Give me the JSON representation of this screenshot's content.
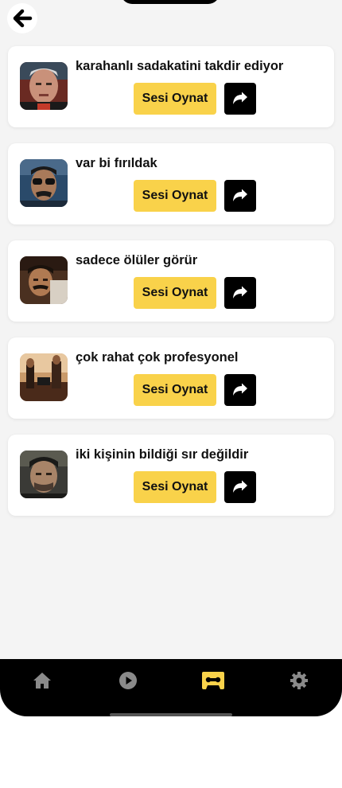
{
  "header": {
    "back_icon": "arrow-left-icon"
  },
  "sounds": [
    {
      "title": "karahanlı sadakatini takdir ediyor",
      "play_label": "Sesi Oynat",
      "share_icon": "share-arrow-icon"
    },
    {
      "title": "var bi fırıldak",
      "play_label": "Sesi Oynat",
      "share_icon": "share-arrow-icon"
    },
    {
      "title": "sadece ölüler görür",
      "play_label": "Sesi Oynat",
      "share_icon": "share-arrow-icon"
    },
    {
      "title": "çok rahat çok profesyonel",
      "play_label": "Sesi Oynat",
      "share_icon": "share-arrow-icon"
    },
    {
      "title": "iki kişinin bildiği sır değildir",
      "play_label": "Sesi Oynat",
      "share_icon": "share-arrow-icon"
    }
  ],
  "tabbar": {
    "items": [
      {
        "icon": "home-icon",
        "active": false
      },
      {
        "icon": "play-circle-icon",
        "active": false
      },
      {
        "icon": "cassette-icon",
        "active": true
      },
      {
        "icon": "gear-icon",
        "active": false
      }
    ],
    "active_color": "#f9d24a",
    "inactive_color": "#8a8a8a"
  },
  "colors": {
    "accent": "#f9d24a",
    "background": "#f4f4f4",
    "card": "#ffffff"
  }
}
